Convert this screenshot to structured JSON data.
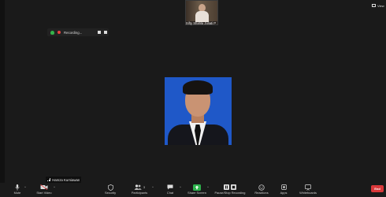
{
  "top": {
    "thumbnail_name": "Sifty Shahla Juliati P",
    "view_label": "View"
  },
  "recording": {
    "label": "Recording..."
  },
  "speaker": {
    "name": "Hamza Kurniawan"
  },
  "toolbar": {
    "mute": "Mute",
    "start_video": "Start Video",
    "security": "Security",
    "participants": "Participants",
    "participants_count": "3",
    "chat": "Chat",
    "share_screen": "Share Screen",
    "pause_recording": "Pause/Stop Recording",
    "reactions": "Reactions",
    "apps": "Apps",
    "whiteboards": "Whiteboards",
    "end": "End"
  },
  "colors": {
    "share": "#2db24c",
    "end": "#d9383a",
    "photo_bg": "#1f58c8",
    "record": "#e84040"
  }
}
